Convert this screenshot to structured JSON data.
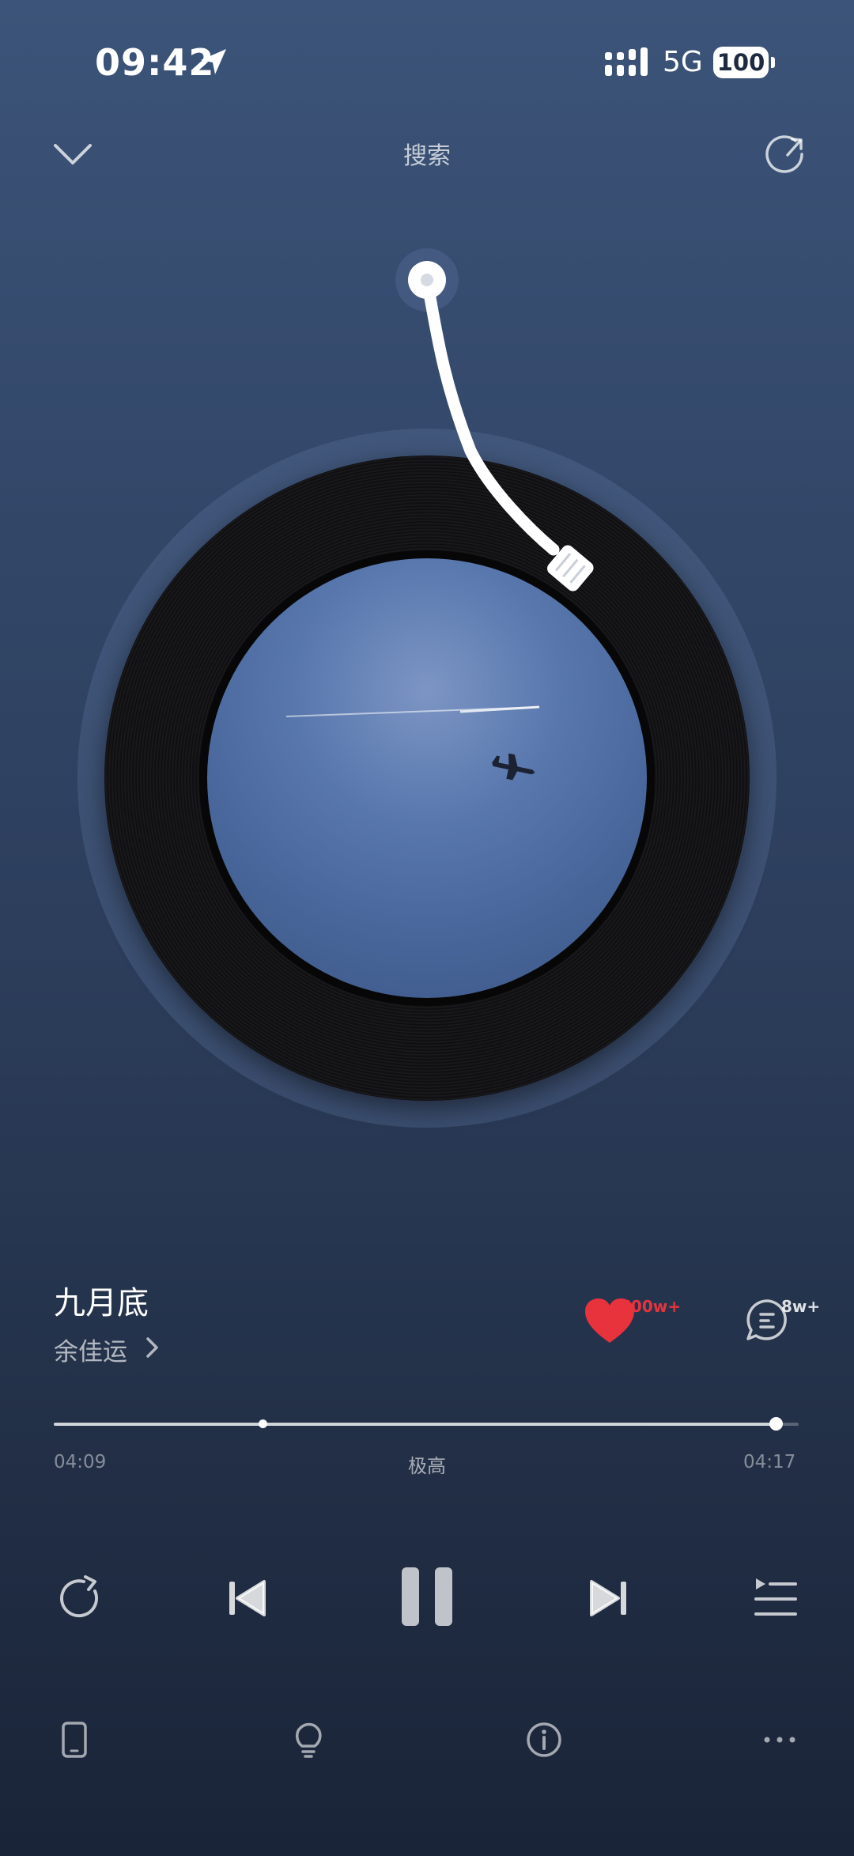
{
  "status_bar": {
    "time": "09:42",
    "network": "5G",
    "battery": "100"
  },
  "header": {
    "title": "搜索",
    "icons": [
      "chevron-down-icon",
      "share-icon"
    ]
  },
  "song": {
    "title": "九月底",
    "artist": "余佳运",
    "like_count": "600w+",
    "comment_count": "8w+"
  },
  "progress": {
    "current": "04:09",
    "total": "04:17",
    "quality": "极高",
    "fraction": 0.969,
    "buffer_fraction": 0.28
  },
  "colors": {
    "accent_like": "#e8333d",
    "background_top": "#3c5479",
    "background_bottom": "#1a2438"
  },
  "controls": [
    "repeat-icon",
    "previous-icon",
    "pause-icon",
    "next-icon",
    "playlist-icon"
  ],
  "bottom_bar": [
    "device-icon",
    "lightbulb-icon",
    "info-icon",
    "more-icon"
  ]
}
